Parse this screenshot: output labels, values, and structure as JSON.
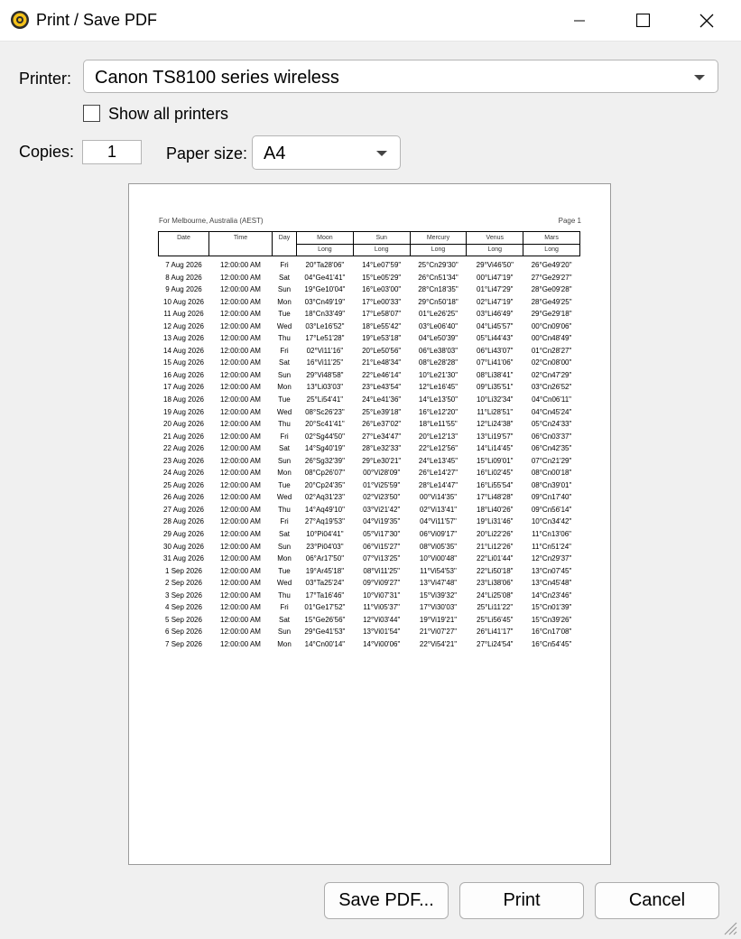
{
  "window": {
    "title": "Print / Save PDF",
    "icon": "sun-gear-icon",
    "controls": [
      "minimize-icon",
      "maximize-icon",
      "close-icon"
    ]
  },
  "printer": {
    "label": "Printer:",
    "value": "Canon TS8100 series wireless"
  },
  "show_all_printers": {
    "label": "Show all printers",
    "checked": false
  },
  "copies": {
    "label": "Copies:",
    "value": "1"
  },
  "paper_size": {
    "label": "Paper size:",
    "value": "A4"
  },
  "preview": {
    "location": "For Melbourne, Australia (AEST)",
    "page": "Page 1",
    "columns": [
      "Date",
      "Time",
      "Day",
      "Moon",
      "Sun",
      "Mercury",
      "Venus",
      "Mars"
    ],
    "subheader": "Long",
    "rows": [
      [
        "7 Aug 2026",
        "12:00:00 AM",
        "Fri",
        "20°Ta28'06\"",
        "14°Le07'59\"",
        "25°Cn29'30\"",
        "29°Vi46'50\"",
        "26°Ge49'20\""
      ],
      [
        "8 Aug 2026",
        "12:00:00 AM",
        "Sat",
        "04°Ge41'41\"",
        "15°Le05'29\"",
        "26°Cn51'34\"",
        "00°Li47'19\"",
        "27°Ge29'27\""
      ],
      [
        "9 Aug 2026",
        "12:00:00 AM",
        "Sun",
        "19°Ge10'04\"",
        "16°Le03'00\"",
        "28°Cn18'35\"",
        "01°Li47'29\"",
        "28°Ge09'28\""
      ],
      [
        "10 Aug 2026",
        "12:00:00 AM",
        "Mon",
        "03°Cn49'19\"",
        "17°Le00'33\"",
        "29°Cn50'18\"",
        "02°Li47'19\"",
        "28°Ge49'25\""
      ],
      [
        "11 Aug 2026",
        "12:00:00 AM",
        "Tue",
        "18°Cn33'49\"",
        "17°Le58'07\"",
        "01°Le26'25\"",
        "03°Li46'49\"",
        "29°Ge29'18\""
      ],
      [
        "12 Aug 2026",
        "12:00:00 AM",
        "Wed",
        "03°Le16'52\"",
        "18°Le55'42\"",
        "03°Le06'40\"",
        "04°Li45'57\"",
        "00°Cn09'06\""
      ],
      [
        "13 Aug 2026",
        "12:00:00 AM",
        "Thu",
        "17°Le51'28\"",
        "19°Le53'18\"",
        "04°Le50'39\"",
        "05°Li44'43\"",
        "00°Cn48'49\""
      ],
      [
        "14 Aug 2026",
        "12:00:00 AM",
        "Fri",
        "02°Vi11'16\"",
        "20°Le50'56\"",
        "06°Le38'03\"",
        "06°Li43'07\"",
        "01°Cn28'27\""
      ],
      [
        "15 Aug 2026",
        "12:00:00 AM",
        "Sat",
        "16°Vi11'25\"",
        "21°Le48'34\"",
        "08°Le28'28\"",
        "07°Li41'06\"",
        "02°Cn08'00\""
      ],
      [
        "16 Aug 2026",
        "12:00:00 AM",
        "Sun",
        "29°Vi48'58\"",
        "22°Le46'14\"",
        "10°Le21'30\"",
        "08°Li38'41\"",
        "02°Cn47'29\""
      ],
      [
        "17 Aug 2026",
        "12:00:00 AM",
        "Mon",
        "13°Li03'03\"",
        "23°Le43'54\"",
        "12°Le16'45\"",
        "09°Li35'51\"",
        "03°Cn26'52\""
      ],
      [
        "18 Aug 2026",
        "12:00:00 AM",
        "Tue",
        "25°Li54'41\"",
        "24°Le41'36\"",
        "14°Le13'50\"",
        "10°Li32'34\"",
        "04°Cn06'11\""
      ],
      [
        "19 Aug 2026",
        "12:00:00 AM",
        "Wed",
        "08°Sc26'23\"",
        "25°Le39'18\"",
        "16°Le12'20\"",
        "11°Li28'51\"",
        "04°Cn45'24\""
      ],
      [
        "20 Aug 2026",
        "12:00:00 AM",
        "Thu",
        "20°Sc41'41\"",
        "26°Le37'02\"",
        "18°Le11'55\"",
        "12°Li24'38\"",
        "05°Cn24'33\""
      ],
      [
        "21 Aug 2026",
        "12:00:00 AM",
        "Fri",
        "02°Sg44'50\"",
        "27°Le34'47\"",
        "20°Le12'13\"",
        "13°Li19'57\"",
        "06°Cn03'37\""
      ],
      [
        "22 Aug 2026",
        "12:00:00 AM",
        "Sat",
        "14°Sg40'19\"",
        "28°Le32'33\"",
        "22°Le12'56\"",
        "14°Li14'45\"",
        "06°Cn42'35\""
      ],
      [
        "23 Aug 2026",
        "12:00:00 AM",
        "Sun",
        "26°Sg32'39\"",
        "29°Le30'21\"",
        "24°Le13'45\"",
        "15°Li09'01\"",
        "07°Cn21'29\""
      ],
      [
        "24 Aug 2026",
        "12:00:00 AM",
        "Mon",
        "08°Cp26'07\"",
        "00°Vi28'09\"",
        "26°Le14'27\"",
        "16°Li02'45\"",
        "08°Cn00'18\""
      ],
      [
        "25 Aug 2026",
        "12:00:00 AM",
        "Tue",
        "20°Cp24'35\"",
        "01°Vi25'59\"",
        "28°Le14'47\"",
        "16°Li55'54\"",
        "08°Cn39'01\""
      ],
      [
        "26 Aug 2026",
        "12:00:00 AM",
        "Wed",
        "02°Aq31'23\"",
        "02°Vi23'50\"",
        "00°Vi14'35\"",
        "17°Li48'28\"",
        "09°Cn17'40\""
      ],
      [
        "27 Aug 2026",
        "12:00:00 AM",
        "Thu",
        "14°Aq49'10\"",
        "03°Vi21'42\"",
        "02°Vi13'41\"",
        "18°Li40'26\"",
        "09°Cn56'14\""
      ],
      [
        "28 Aug 2026",
        "12:00:00 AM",
        "Fri",
        "27°Aq19'53\"",
        "04°Vi19'35\"",
        "04°Vi11'57\"",
        "19°Li31'46\"",
        "10°Cn34'42\""
      ],
      [
        "29 Aug 2026",
        "12:00:00 AM",
        "Sat",
        "10°Pi04'41\"",
        "05°Vi17'30\"",
        "06°Vi09'17\"",
        "20°Li22'26\"",
        "11°Cn13'06\""
      ],
      [
        "30 Aug 2026",
        "12:00:00 AM",
        "Sun",
        "23°Pi04'03\"",
        "06°Vi15'27\"",
        "08°Vi05'35\"",
        "21°Li12'26\"",
        "11°Cn51'24\""
      ],
      [
        "31 Aug 2026",
        "12:00:00 AM",
        "Mon",
        "06°Ar17'50\"",
        "07°Vi13'25\"",
        "10°Vi00'48\"",
        "22°Li01'44\"",
        "12°Cn29'37\""
      ],
      [
        "1 Sep 2026",
        "12:00:00 AM",
        "Tue",
        "19°Ar45'18\"",
        "08°Vi11'25\"",
        "11°Vi54'53\"",
        "22°Li50'18\"",
        "13°Cn07'45\""
      ],
      [
        "2 Sep 2026",
        "12:00:00 AM",
        "Wed",
        "03°Ta25'24\"",
        "09°Vi09'27\"",
        "13°Vi47'48\"",
        "23°Li38'06\"",
        "13°Cn45'48\""
      ],
      [
        "3 Sep 2026",
        "12:00:00 AM",
        "Thu",
        "17°Ta16'46\"",
        "10°Vi07'31\"",
        "15°Vi39'32\"",
        "24°Li25'08\"",
        "14°Cn23'46\""
      ],
      [
        "4 Sep 2026",
        "12:00:00 AM",
        "Fri",
        "01°Ge17'52\"",
        "11°Vi05'37\"",
        "17°Vi30'03\"",
        "25°Li11'22\"",
        "15°Cn01'39\""
      ],
      [
        "5 Sep 2026",
        "12:00:00 AM",
        "Sat",
        "15°Ge26'56\"",
        "12°Vi03'44\"",
        "19°Vi19'21\"",
        "25°Li56'45\"",
        "15°Cn39'26\""
      ],
      [
        "6 Sep 2026",
        "12:00:00 AM",
        "Sun",
        "29°Ge41'53\"",
        "13°Vi01'54\"",
        "21°Vi07'27\"",
        "26°Li41'17\"",
        "16°Cn17'08\""
      ],
      [
        "7 Sep 2026",
        "12:00:00 AM",
        "Mon",
        "14°Cn00'14\"",
        "14°Vi00'06\"",
        "22°Vi54'21\"",
        "27°Li24'54\"",
        "16°Cn54'45\""
      ]
    ]
  },
  "buttons": {
    "save_pdf": "Save PDF...",
    "print": "Print",
    "cancel": "Cancel"
  }
}
